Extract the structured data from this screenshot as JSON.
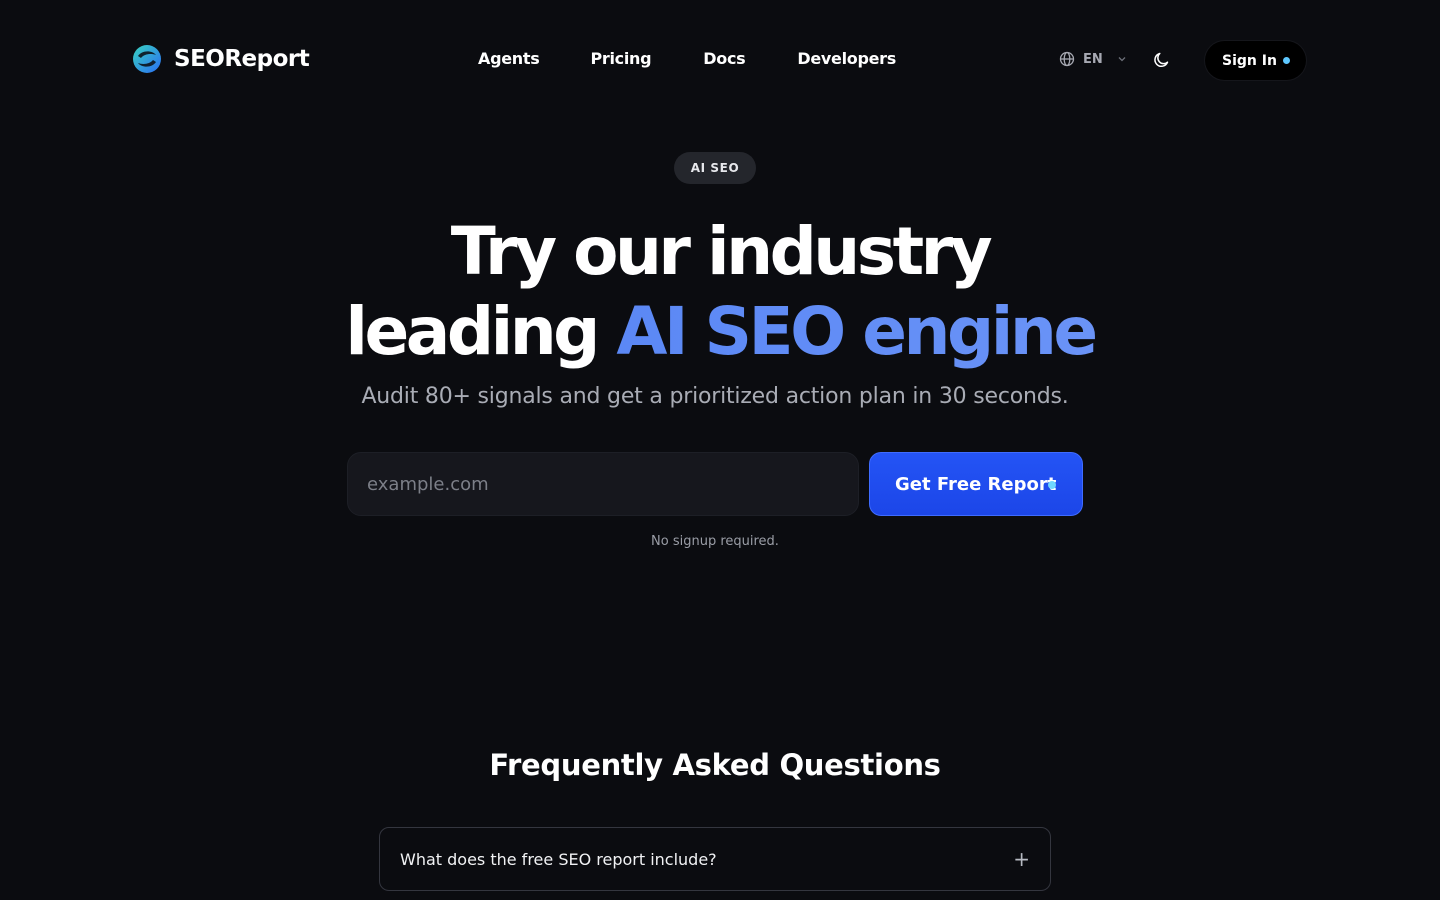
{
  "header": {
    "brand": "SEOReport",
    "nav": [
      "Agents",
      "Pricing",
      "Docs",
      "Developers"
    ],
    "language": "EN",
    "sign_in_label": "Sign In"
  },
  "hero": {
    "badge": "AI SEO",
    "title_line1": "Try our industry",
    "title_line2_plain": "leading ",
    "title_line2_accent": "AI SEO engine",
    "subtitle": "Audit 80+ signals and get a prioritized action plan in 30 seconds.",
    "input_placeholder": "example.com",
    "input_value": "",
    "cta_label": "Get Free Report",
    "note": "No signup required."
  },
  "faq": {
    "title": "Frequently Asked Questions",
    "items": [
      {
        "question": "What does the free SEO report include?",
        "toggle": "+"
      }
    ]
  },
  "colors": {
    "background": "#0b0c10",
    "accent": "#5b88f5",
    "cta": "#2151f2",
    "status_dot": "#5ec8ff"
  },
  "icons": {
    "brand": "logo-swirl-icon",
    "language": "globe-icon",
    "dropdown": "chevron-down-icon",
    "theme": "moon-icon"
  }
}
